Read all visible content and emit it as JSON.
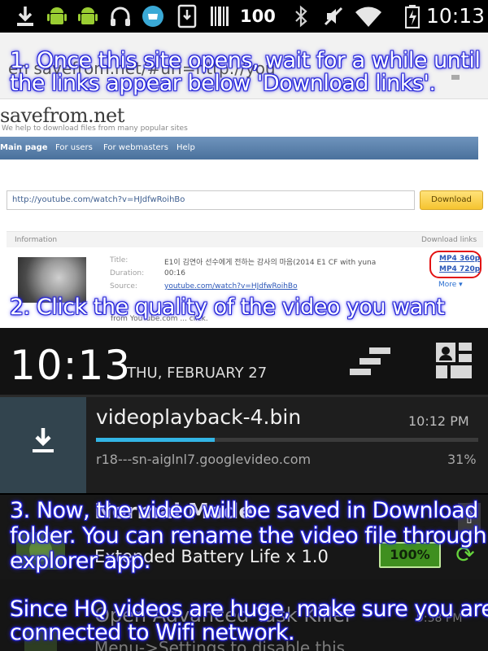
{
  "status_bar": {
    "battery_level": "100",
    "time": "10:13"
  },
  "browser": {
    "url_fragment": "en savefrom.net/#url=http://you",
    "brand": "savefrom.net",
    "tagline": "We help to download files from many popular sites",
    "nav": [
      "Main page",
      "For users",
      "For webmasters",
      "Help"
    ],
    "input_value": "http://youtube.com/watch?v=HJdfwRoihBo",
    "download_button": "Download",
    "information_label": "Information",
    "download_links_label": "Download links",
    "meta": {
      "title_label": "Title:",
      "title_value": "E1이 김연아 선수에게 전하는 감사의 마음(2014 E1 CF with yuna",
      "duration_label": "Duration:",
      "duration_value": "00:16",
      "source_label": "Source:",
      "source_value": "youtube.com/watch?v=HJdfwRoihBo"
    },
    "quality_links": [
      "MP4 360p",
      "MP4 720p"
    ],
    "more_label": "More ▾",
    "footnote": "from YouTube.com ... click."
  },
  "shade": {
    "time": "10:13",
    "date": "THU, FEBRUARY 27"
  },
  "download_notification": {
    "filename": "videoplayback-4.bin",
    "time": "10:12 PM",
    "source": "r18---sn-aiglnl7.googlevideo.com",
    "percent_label": "31%",
    "progress": 0.31
  },
  "battery_notification": {
    "title": "Normal Mode",
    "body": "Extended Battery Life x 1.0",
    "badge": "100%"
  },
  "task_notification": {
    "title": "Open Advanced Task Killer",
    "body": "Menu->Settings to disable this.",
    "time": "9:38 PM"
  },
  "captions": {
    "step1_line1": "1. Once this site opens, wait for a while until",
    "step1_line2": "the links appear below 'Download links'.",
    "step2": "2. Click the quality of the video you want",
    "step3_line1": "3. Now, the video will be saved in Download",
    "step3_line2": "folder. You can rename the video file through",
    "step3_line3": "explorer app.",
    "note_line1": "Since HQ videos are huge, make sure you are",
    "note_line2": "connected to Wifi network."
  },
  "colors": {
    "caption_glow": "#1a1bd6",
    "progress": "#33b5e5",
    "quality_circle": "#e31313",
    "battery_badge": "#3f8f1f"
  },
  "icons": [
    "download-icon",
    "android-icon",
    "android-icon",
    "headphones-icon",
    "app-icon",
    "sd-card-icon",
    "barcode-icon",
    "bluetooth-icon",
    "mute-icon",
    "wifi-icon",
    "battery-icon",
    "settings-toggle-icon",
    "user-menu-icon",
    "refresh-icon",
    "arrow-up-icon"
  ]
}
